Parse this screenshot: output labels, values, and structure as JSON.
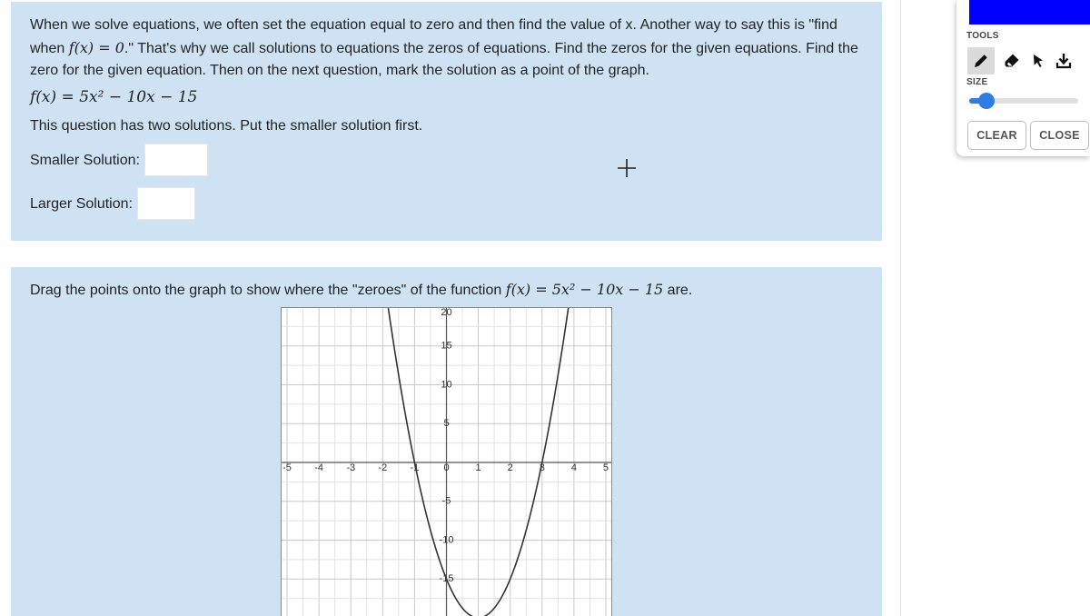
{
  "question1": {
    "paragraph": "When we solve equations, we often set the equation equal to zero and then find the value of x. Another way to say this is \"find when ",
    "fx": "f(x)",
    "eq_zero": " = 0",
    "paragraph_rest": ".\" That's why we call solutions to equations the zeros of equations. Find the zeros for the given equations.  Find the zero for the given equation.  Then on the next question, mark the solution as a point of the graph.",
    "formula": "f(x) = 5x² − 10x − 15",
    "note": "This question has two solutions.  Put the smaller solution first.",
    "smaller_label": "Smaller Solution:",
    "smaller_value": "",
    "larger_label": "Larger Solution:",
    "larger_value": ""
  },
  "question2": {
    "text_before": "Drag the points onto the graph to show where the \"zeroes\" of the function ",
    "formula": "f(x) = 5x² − 10x − 15",
    "text_after": " are."
  },
  "chart_data": {
    "type": "line",
    "function": "5x^2 - 10x - 15",
    "xlim": [
      -5.2,
      5.2
    ],
    "ylim": [
      -20,
      20
    ],
    "grid": true,
    "x_tick_labels": [
      "-5",
      "-4",
      "-3",
      "-2",
      "-1",
      "0",
      "1",
      "2",
      "3",
      "4",
      "5"
    ],
    "y_tick_labels": [
      "20",
      "15",
      "10",
      "5",
      "-5",
      "-10",
      "-15"
    ],
    "curve_color": "#333333",
    "grid_color": "#cfcfcf"
  },
  "toolbar": {
    "color": "#0000ff",
    "tools_label": "TOOLS",
    "tools": [
      "pen-icon",
      "eraser-icon",
      "pointer-icon",
      "download-icon"
    ],
    "size_label": "SIZE",
    "size_value": 0.1,
    "clear_label": "CLEAR",
    "close_label": "CLOSE",
    "accent_color": "#2f7de1"
  }
}
